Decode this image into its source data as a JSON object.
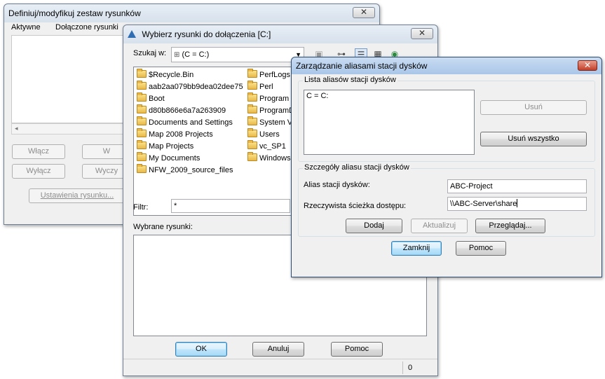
{
  "win1": {
    "title": "Definiuj/modyfikuj zestaw rysunków",
    "close": "✕",
    "col_active": "Aktywne",
    "col_attached": "Dołączone rysunki",
    "btn_enable": "Włącz",
    "btn_enable2": "W",
    "btn_disable": "Wyłącz",
    "btn_clear": "Wyczy",
    "btn_settings": "Ustawienia rysunku..."
  },
  "win2": {
    "title": "Wybierz rysunki do dołączenia [C:]",
    "close": "✕",
    "search_label": "Szukaj w:",
    "search_value": "(C = C:)",
    "files_col1": [
      "$Recycle.Bin",
      "aab2aa079bb9dea02dee75",
      "Boot",
      "d80b866e6a7a263909",
      "Documents and Settings",
      "Map 2008 Projects",
      "Map Projects",
      "My Documents",
      "NFW_2009_source_files"
    ],
    "files_col2": [
      "PerfLogs",
      "Perl",
      "Program",
      "ProgramD",
      "System V",
      "Users",
      "vc_SP1",
      "Windows"
    ],
    "filter_label": "Filtr:",
    "filter_value": "*",
    "selected_label": "Wybrane rysunki:",
    "ok": "OK",
    "cancel": "Anuluj",
    "help": "Pomoc",
    "status_count": "0"
  },
  "win3": {
    "title": "Zarządzanie aliasami stacji dysków",
    "close": "✕",
    "list_group": "Lista aliasów stacji dysków",
    "list_items": [
      "C = C:"
    ],
    "remove": "Usuń",
    "remove_all": "Usuń wszystko",
    "details_group": "Szczegóły aliasu stacji dysków",
    "alias_label": "Alias stacji dysków:",
    "alias_value": "ABC-Project",
    "path_label": "Rzeczywista ścieżka dostępu:",
    "path_value": "\\\\ABC-Server\\share",
    "add": "Dodaj",
    "update": "Aktualizuj",
    "browse": "Przeglądaj...",
    "close_btn": "Zamknij",
    "help": "Pomoc"
  }
}
